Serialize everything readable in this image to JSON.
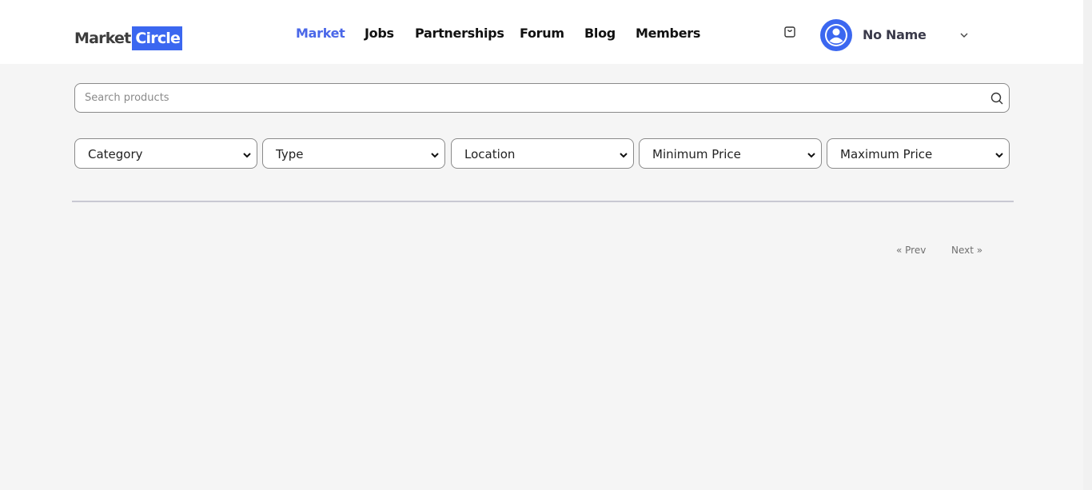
{
  "header": {
    "logo": {
      "word1": "Market",
      "word2": "Circle"
    },
    "nav": [
      {
        "label": "Market",
        "active": true
      },
      {
        "label": "Jobs",
        "active": false
      },
      {
        "label": "Partnerships",
        "active": false
      },
      {
        "label": "Forum",
        "active": false
      },
      {
        "label": "Blog",
        "active": false
      },
      {
        "label": "Members",
        "active": false
      }
    ],
    "cart_icon": "shopping-bag-icon",
    "avatar_icon": "user-circle-icon",
    "user_name": "No Name",
    "user_menu_icon": "chevron-down-icon"
  },
  "search": {
    "placeholder": "Search products",
    "value": "",
    "icon": "search-icon"
  },
  "filters": [
    {
      "label": "Category"
    },
    {
      "label": "Type"
    },
    {
      "label": "Location"
    },
    {
      "label": "Minimum Price"
    },
    {
      "label": "Maximum Price"
    }
  ],
  "pagination": {
    "prev_label": "« Prev",
    "next_label": "Next »"
  },
  "colors": {
    "accent": "#3b67f0",
    "nav_active": "#4a67e8",
    "page_background": "#f5f5f5",
    "header_background": "#ffffff"
  }
}
